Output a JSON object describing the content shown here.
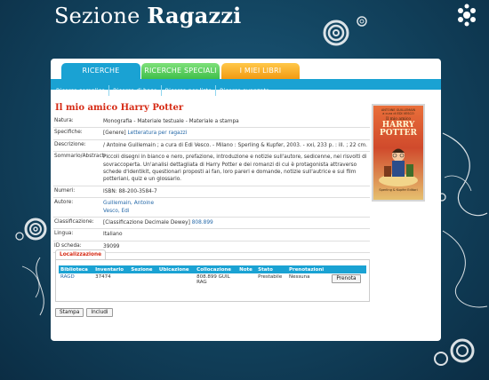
{
  "site": {
    "title_light": "Sezione ",
    "title_bold": "Ragazzi"
  },
  "tabs": [
    {
      "label": "RICERCHE"
    },
    {
      "label": "RICERCHE SPECIALI"
    },
    {
      "label": "I MIEI LIBRI"
    }
  ],
  "subnav": [
    "Ricerca semplice",
    "Ricerca di base",
    "Ricerca per liste",
    "Ricerca avanzata"
  ],
  "book": {
    "title": "Il mio amico Harry Potter",
    "natura_label": "Natura:",
    "natura": "Monografia - Materiale testuale - Materiale a stampa",
    "specifiche_label": "Specifiche:",
    "specifiche_prefix": "[Genere] ",
    "specifiche_link": "Letteratura per ragazzi",
    "descrizione_label": "Descrizione:",
    "descrizione": "/ Antoine Guillemain ; a cura di Edi Vesco. - Milano : Sperling & Kupfer, 2003. - xxi, 233 p. : ill. ; 22 cm.",
    "sommario_label": "Sommario/Abstract:",
    "sommario": "Piccoli disegni in bianco e nero, prefazione, introduzione e notizie sull'autore, sedicenne, nei risvolti di sovraccoperta. Un'analisi dettagliata di Harry Potter e dei romanzi di cui è protagonista attraverso schede d'identikit, questionari proposti ai fan, loro pareri e domande, notizie sull'autrice e sui film potteriani, quiz e un glossario.",
    "numeri_label": "Numeri:",
    "numeri": "ISBN: 88-200-3584-7",
    "autore_label": "Autore:",
    "autore1": "Guillemain, Antoine",
    "autore2": "Vesco, Edi",
    "classificazione_label": "Classificazione:",
    "classificazione_prefix": "[Classificazione Decimale Dewey] ",
    "classificazione_link": "808.899",
    "lingua_label": "Lingua:",
    "lingua": "Italiano",
    "id_label": "ID scheda:",
    "id": "39099"
  },
  "cover": {
    "author": "ANTOINE GUILLEMAIN",
    "subtitle": "a cura di EDI VESCO",
    "line1": "Il mio amico",
    "line2": "HARRY",
    "line3": "POTTER",
    "publisher": "Sperling & Kupfer Editori"
  },
  "localizzazione": {
    "tab_label": "Localizzazione",
    "headers": [
      "Biblioteca",
      "Inventario",
      "Sezione",
      "Ubicazione",
      "Collocazione",
      "Note",
      "Stato",
      "Prenotazioni"
    ],
    "row": {
      "biblioteca": "RAGD",
      "inventario": "37474",
      "sezione": "",
      "ubicazione": "",
      "collocazione": "808.899 GUIL RAG",
      "note": "",
      "stato": "Prestabile",
      "prenotazioni": "Nessuna",
      "button": "Prenota"
    }
  },
  "buttons": {
    "stampa": "Stampa",
    "includi": "Includi"
  },
  "colors": {
    "accent": "#1aa2d3",
    "title_red": "#d62a14",
    "tab_green": "#3fbf4a",
    "tab_orange": "#f29a12",
    "bg_dark": "#134662"
  }
}
